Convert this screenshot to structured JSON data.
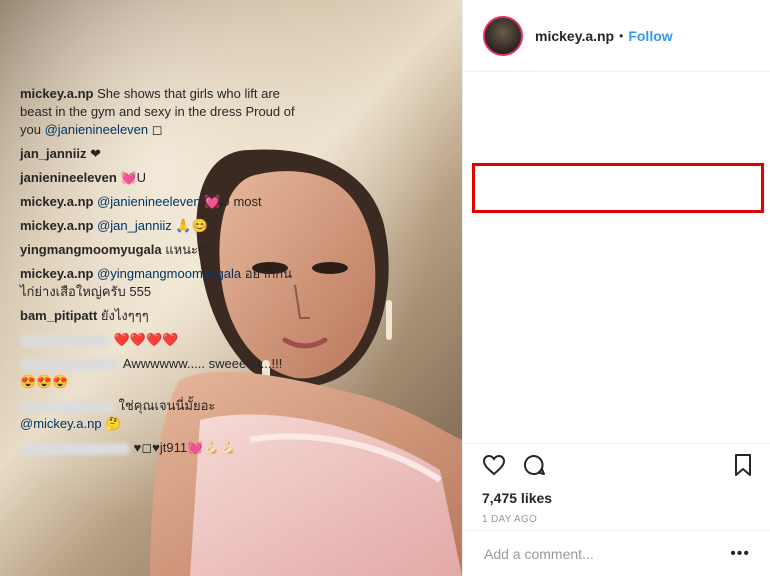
{
  "post": {
    "username": "mickey.a.np",
    "separator": "•",
    "follow_label": "Follow"
  },
  "comments": [
    {
      "user": "mickey.a.np",
      "text": "She shows that girls who lift are beast in the gym and sexy in the dress Proud of you ",
      "mention": "@janienineeleven",
      "tail": " ◻"
    },
    {
      "user": "jan_janniiz",
      "text": "❤",
      "mention": "",
      "tail": ""
    },
    {
      "user": "janienineeleven",
      "text": "💓U",
      "mention": "",
      "tail": ""
    },
    {
      "user": "mickey.a.np",
      "text": "",
      "mention": "@janienineeleven",
      "tail": " 💓U most"
    },
    {
      "user": "mickey.a.np",
      "text": "",
      "mention": "@jan_janniiz",
      "tail": " 🙏😊"
    },
    {
      "user": "yingmangmoomyugala",
      "text": "แหนะ◻",
      "mention": "",
      "tail": ""
    },
    {
      "user": "mickey.a.np",
      "text": "",
      "mention": "@yingmangmoomyugala",
      "tail": " อยากกินไก่ย่างเสือใหญ่ครับ 555"
    },
    {
      "user": "bam_pitipatt",
      "text": "ยังไงๆๆๆ",
      "mention": "",
      "tail": ""
    }
  ],
  "blurred_comments": [
    {
      "text": "❤️❤️❤️❤️"
    },
    {
      "text": "Awwwwww..... sweeetttt...!!! 😍😍😍"
    },
    {
      "text": "ใช่คุณเจนนี่มั้ยอะ ",
      "mention": "@mickey.a.np",
      "tail": " 🤔"
    },
    {
      "text": "♥◻♥jt911💓💪🏻💪🏻"
    }
  ],
  "likes": "7,475 likes",
  "time_ago": "1 DAY AGO",
  "add_comment_placeholder": "Add a comment...",
  "icons": [
    "heart-icon",
    "comment-icon",
    "bookmark-icon",
    "more-icon"
  ],
  "colors": {
    "link": "#3897f0",
    "mention": "#003569",
    "highlight": "#e00000"
  }
}
